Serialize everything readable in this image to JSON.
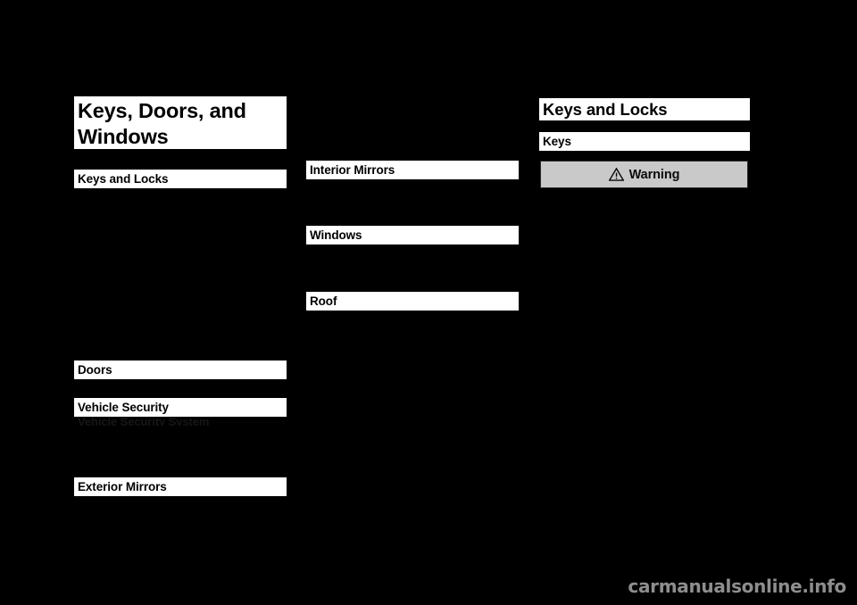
{
  "document": {
    "background_color": "#000000",
    "text_color": "#000000",
    "bar_color": "#ffffff"
  },
  "chapter": {
    "title": "Keys, Doors, and Windows"
  },
  "columns": {
    "left": {
      "entries": [
        {
          "label": "Keys and Locks"
        },
        {
          "label": "Doors"
        },
        {
          "label": "Vehicle Security"
        },
        {
          "label": "Exterior Mirrors"
        }
      ],
      "ghost_entry": "Vehicle Security System"
    },
    "middle": {
      "entries": [
        {
          "label": "Interior Mirrors"
        },
        {
          "label": "Windows"
        },
        {
          "label": "Roof"
        }
      ]
    },
    "right": {
      "section_heading": "Keys and Locks",
      "sub_heading": "Keys",
      "warning": {
        "label": "Warning",
        "icon": "warning-triangle-icon",
        "background_color": "#c9c9c9",
        "border_color": "#2a2a2a"
      }
    }
  },
  "watermark": {
    "text": "carmanualsonline.info",
    "color": "#8e8e8e"
  }
}
